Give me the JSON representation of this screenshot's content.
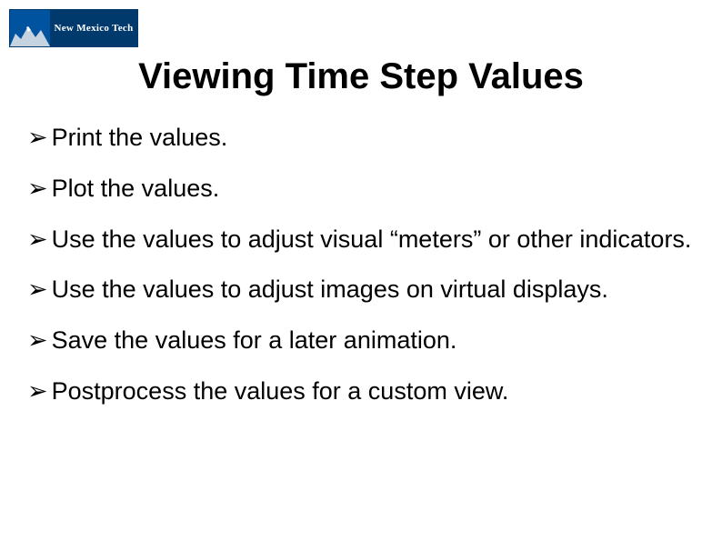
{
  "logo": {
    "text": "New Mexico Tech"
  },
  "title": "Viewing Time Step Values",
  "bullet_marker": "➢",
  "bullets": [
    "Print the values.",
    "Plot the values.",
    "Use the values to adjust visual “meters” or other indicators.",
    "Use the values to adjust images on virtual displays.",
    "Save the values for a later animation.",
    "Postprocess the values for a custom view."
  ]
}
